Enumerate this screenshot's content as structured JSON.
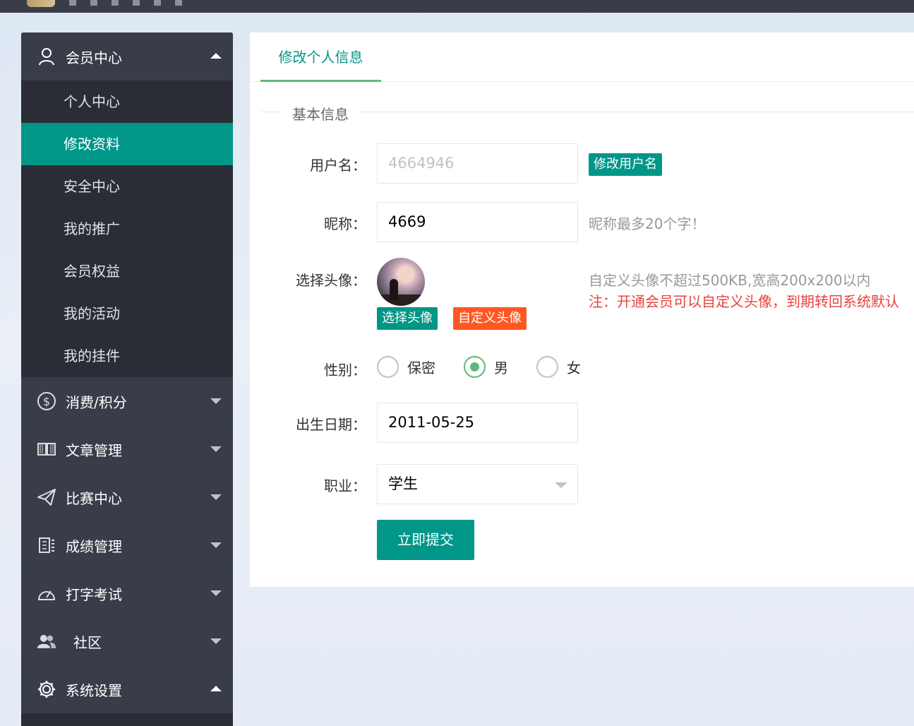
{
  "sidebar": {
    "member_center": {
      "label": "会员中心",
      "items": [
        {
          "label": "个人中心"
        },
        {
          "label": "修改资料"
        },
        {
          "label": "安全中心"
        },
        {
          "label": "我的推广"
        },
        {
          "label": "会员权益"
        },
        {
          "label": "我的活动"
        },
        {
          "label": "我的挂件"
        }
      ]
    },
    "groups": [
      {
        "label": "消费/积分",
        "icon": "dollar-icon"
      },
      {
        "label": "文章管理",
        "icon": "book-icon"
      },
      {
        "label": "比赛中心",
        "icon": "paper-plane-icon"
      },
      {
        "label": "成绩管理",
        "icon": "score-icon"
      },
      {
        "label": "打字考试",
        "icon": "gauge-icon"
      },
      {
        "label": "社区",
        "icon": "users-icon"
      },
      {
        "label": "系统设置",
        "icon": "gear-icon"
      }
    ]
  },
  "main": {
    "tab_label": "修改个人信息",
    "section_title": "基本信息",
    "username": {
      "label": "用户名：",
      "value": "4664946",
      "button": "修改用户名"
    },
    "nickname": {
      "label": "昵称：",
      "value": "4669",
      "hint": "昵称最多20个字！"
    },
    "avatar": {
      "label": "选择头像：",
      "choose_button": "选择头像",
      "custom_button": "自定义头像",
      "hint": "自定义头像不超过500KB,宽高200x200以内",
      "note": "注：开通会员可以自定义头像，到期转回系统默认"
    },
    "gender": {
      "label": "性别：",
      "options": [
        "保密",
        "男",
        "女"
      ],
      "selected": "男"
    },
    "birthday": {
      "label": "出生日期：",
      "value": "2011-05-25"
    },
    "occupation": {
      "label": "职业：",
      "value": "学生"
    },
    "submit_label": "立即提交"
  },
  "colors": {
    "accent": "#009688",
    "radio_checked": "#5fb878",
    "orange": "#ff5722",
    "note_red": "#e8423d",
    "sidebar_bg": "#393d49",
    "submenu_bg": "#2a2d36"
  }
}
